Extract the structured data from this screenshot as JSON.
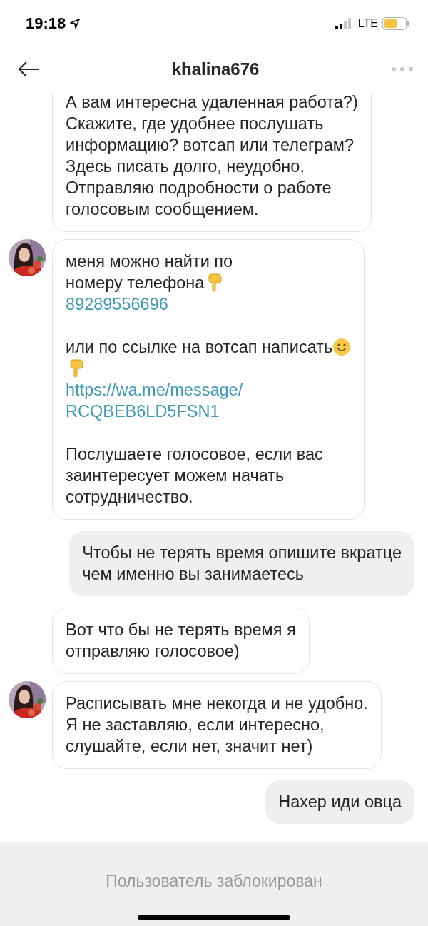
{
  "status_bar": {
    "time": "19:18",
    "network": "LTE"
  },
  "header": {
    "title": "khalina676"
  },
  "messages": [
    {
      "kind": "incoming",
      "show_avatar": false,
      "paragraphs": [
        {
          "lines": [
            [
              {
                "kind": "text",
                "text": "А вам интересна удаленная работа?)"
              }
            ],
            [
              {
                "kind": "text",
                "text": "Скажите, где удобнее послушать"
              }
            ],
            [
              {
                "kind": "text",
                "text": "информацию? вотсап или телеграм?"
              }
            ],
            [
              {
                "kind": "text",
                "text": "Здесь писать долго, неудобно."
              }
            ],
            [
              {
                "kind": "text",
                "text": "Отправляю подробности о работе"
              }
            ],
            [
              {
                "kind": "text",
                "text": "голосовым сообщением."
              }
            ]
          ]
        }
      ]
    },
    {
      "kind": "incoming",
      "show_avatar": true,
      "paragraphs": [
        {
          "lines": [
            [
              {
                "kind": "text",
                "text": "меня можно найти по"
              }
            ],
            [
              {
                "kind": "text",
                "text": "номеру телефона"
              },
              {
                "kind": "point-down"
              }
            ],
            [
              {
                "kind": "link",
                "text": "89289556696"
              }
            ]
          ]
        },
        {
          "lines": [
            [
              {
                "kind": "text",
                "text": "или по ссылке на вотсап написать"
              },
              {
                "kind": "smile"
              }
            ],
            [
              {
                "kind": "point-down"
              }
            ],
            [
              {
                "kind": "link",
                "text": "https://wa.me/message/"
              }
            ],
            [
              {
                "kind": "link",
                "text": "RCQBEB6LD5FSN1"
              }
            ]
          ]
        },
        {
          "lines": [
            [
              {
                "kind": "text",
                "text": "Послушаете голосовое, если вас"
              }
            ],
            [
              {
                "kind": "text",
                "text": "заинтересует можем начать"
              }
            ],
            [
              {
                "kind": "text",
                "text": "сотрудничество."
              }
            ]
          ]
        }
      ]
    },
    {
      "kind": "outgoing",
      "paragraphs": [
        {
          "lines": [
            [
              {
                "kind": "text",
                "text": "Чтобы не терять время опишите вкратце"
              }
            ],
            [
              {
                "kind": "text",
                "text": "чем именно вы занимаетесь"
              }
            ]
          ]
        }
      ]
    },
    {
      "kind": "incoming",
      "show_avatar": false,
      "paragraphs": [
        {
          "lines": [
            [
              {
                "kind": "text",
                "text": "Вот что бы не терять время я"
              }
            ],
            [
              {
                "kind": "text",
                "text": "отправляю голосовое)"
              }
            ]
          ]
        }
      ]
    },
    {
      "kind": "incoming",
      "show_avatar": true,
      "paragraphs": [
        {
          "lines": [
            [
              {
                "kind": "text",
                "text": "Расписывать мне некогда и не удобно."
              }
            ],
            [
              {
                "kind": "text",
                "text": "Я не заставляю, если интересно,"
              }
            ],
            [
              {
                "kind": "text",
                "text": "слушайте, если нет, значит нет)"
              }
            ]
          ]
        }
      ]
    },
    {
      "kind": "outgoing",
      "paragraphs": [
        {
          "lines": [
            [
              {
                "kind": "text",
                "text": "Нахер иди овца"
              }
            ]
          ]
        }
      ]
    }
  ],
  "footer": {
    "notice": "Пользователь заблокирован"
  }
}
